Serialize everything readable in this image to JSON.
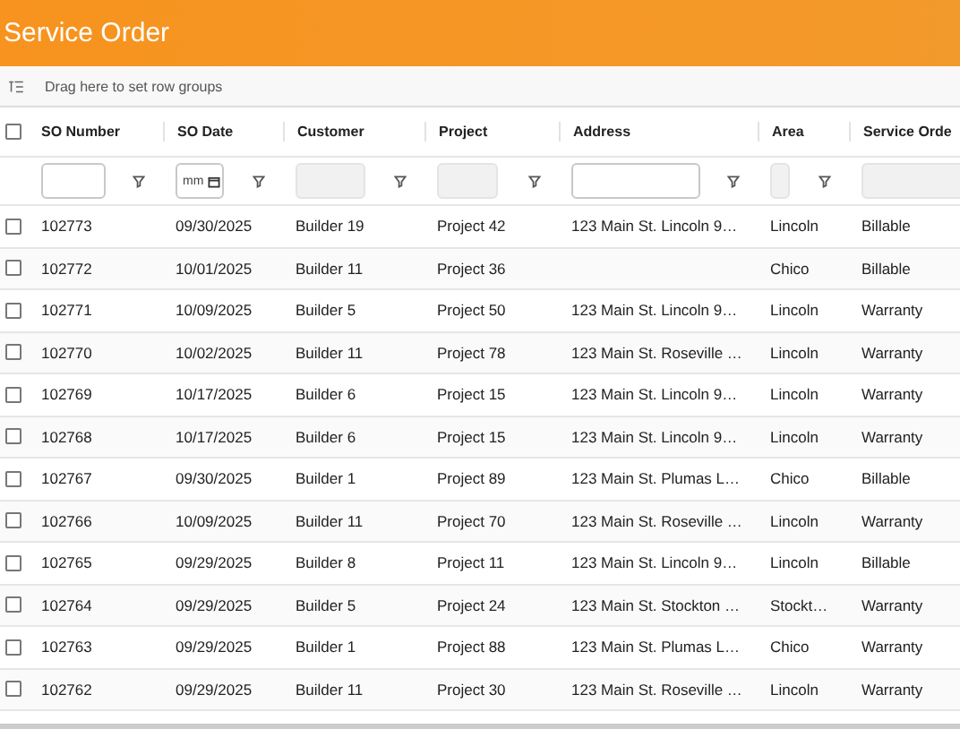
{
  "app_bar": {
    "title": "Service Order"
  },
  "group_panel": {
    "hint": "Drag here to set row groups"
  },
  "table": {
    "select_all": {
      "checked": false
    },
    "columns": [
      {
        "label": "SO Number",
        "filter": {
          "kind": "text",
          "disabled": false
        }
      },
      {
        "label": "SO Date",
        "filter": {
          "kind": "date",
          "disabled": false,
          "placeholder": "mm"
        }
      },
      {
        "label": "Customer",
        "filter": {
          "kind": "text",
          "disabled": true
        }
      },
      {
        "label": "Project",
        "filter": {
          "kind": "text",
          "disabled": true
        }
      },
      {
        "label": "Address",
        "filter": {
          "kind": "text",
          "disabled": false
        }
      },
      {
        "label": "Area",
        "filter": {
          "kind": "text",
          "disabled": true
        }
      },
      {
        "label": "Service Orde",
        "filter": {
          "kind": "text",
          "disabled": true
        }
      }
    ],
    "rows": [
      {
        "checked": false,
        "cells": [
          "102773",
          "09/30/2025",
          "Builder 19",
          "Project 42",
          "123 Main St. Lincoln 9…",
          "Lincoln",
          "Billable"
        ]
      },
      {
        "checked": false,
        "cells": [
          "102772",
          "10/01/2025",
          "Builder 11",
          "Project 36",
          "",
          "Chico",
          "Billable"
        ]
      },
      {
        "checked": false,
        "cells": [
          "102771",
          "10/09/2025",
          "Builder 5",
          "Project 50",
          "123 Main St. Lincoln 9…",
          "Lincoln",
          "Warranty"
        ]
      },
      {
        "checked": false,
        "cells": [
          "102770",
          "10/02/2025",
          "Builder 11",
          "Project 78",
          "123 Main St. Roseville …",
          "Lincoln",
          "Warranty"
        ]
      },
      {
        "checked": false,
        "cells": [
          "102769",
          "10/17/2025",
          "Builder 6",
          "Project 15",
          "123 Main St. Lincoln 9…",
          "Lincoln",
          "Warranty"
        ]
      },
      {
        "checked": false,
        "cells": [
          "102768",
          "10/17/2025",
          "Builder 6",
          "Project 15",
          "123 Main St. Lincoln 9…",
          "Lincoln",
          "Warranty"
        ]
      },
      {
        "checked": false,
        "cells": [
          "102767",
          "09/30/2025",
          "Builder 1",
          "Project 89",
          "123 Main St. Plumas L…",
          "Chico",
          "Billable"
        ]
      },
      {
        "checked": false,
        "cells": [
          "102766",
          "10/09/2025",
          "Builder 11",
          "Project 70",
          "123 Main St. Roseville …",
          "Lincoln",
          "Warranty"
        ]
      },
      {
        "checked": false,
        "cells": [
          "102765",
          "09/29/2025",
          "Builder 8",
          "Project 11",
          "123 Main St. Lincoln 9…",
          "Lincoln",
          "Billable"
        ]
      },
      {
        "checked": false,
        "cells": [
          "102764",
          "09/29/2025",
          "Builder 5",
          "Project 24",
          "123 Main St. Stockton …",
          "Stockt…",
          "Warranty"
        ]
      },
      {
        "checked": false,
        "cells": [
          "102763",
          "09/29/2025",
          "Builder 1",
          "Project 88",
          "123 Main St. Plumas L…",
          "Chico",
          "Warranty"
        ]
      },
      {
        "checked": false,
        "cells": [
          "102762",
          "09/29/2025",
          "Builder 11",
          "Project 30",
          "123 Main St. Roseville …",
          "Lincoln",
          "Warranty"
        ]
      }
    ]
  }
}
